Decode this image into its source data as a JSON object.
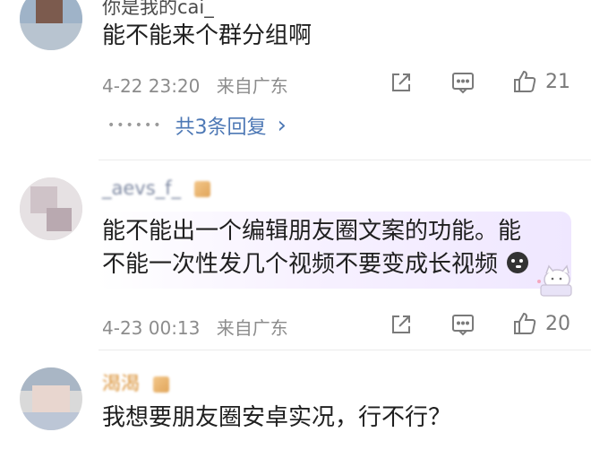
{
  "comments": [
    {
      "username": "你是我的cai_",
      "text": "能不能来个群分组啊",
      "date": "4-22 23:20",
      "location": "来自广东",
      "likes": "21",
      "replies": "共3条回复",
      "replies_arrow": "›"
    },
    {
      "username": "_aevs_f_",
      "text_line1": "能不能出一个编辑朋友圈文案的功能。能",
      "text_line2": "不能一次性发几个视频不要变成长视频",
      "date": "4-23 00:13",
      "location": "来自广东",
      "likes": "20"
    },
    {
      "username": "渴渴",
      "text": "我想要朋友圈安卓实况，行不行？"
    }
  ],
  "icons": {
    "share": "share-icon",
    "comment": "comment-icon",
    "like": "thumbs-up-icon"
  },
  "colors": {
    "link": "#4d78b5",
    "meta": "#8c8c8c",
    "bubble": "#efe7ff"
  }
}
